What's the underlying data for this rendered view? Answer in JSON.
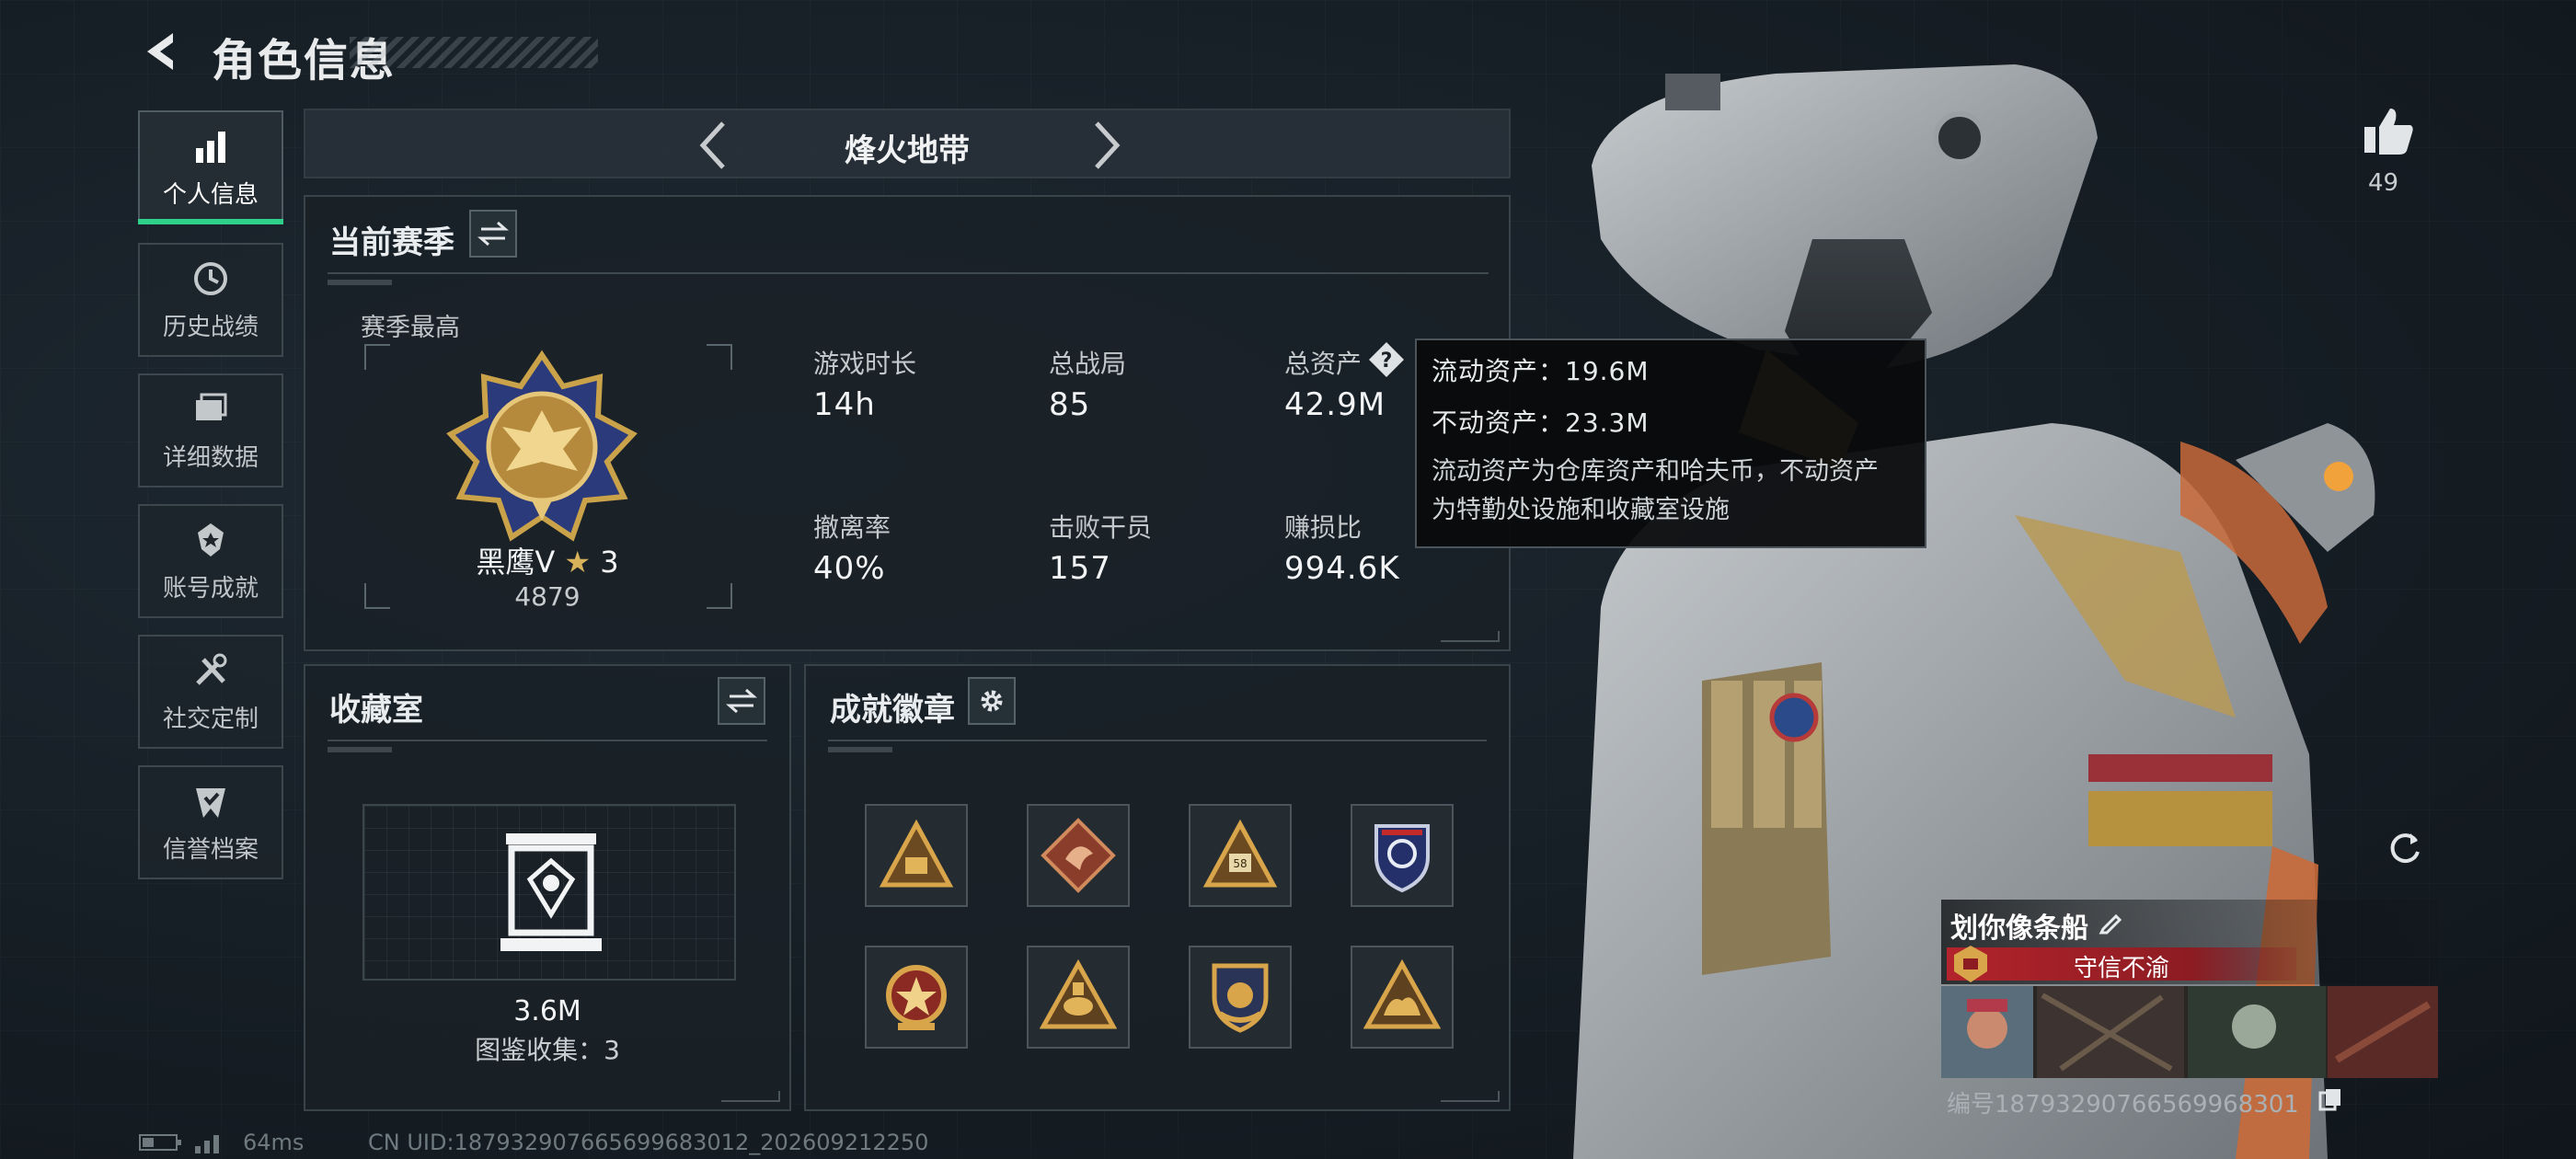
{
  "header": {
    "title": "角色信息"
  },
  "sidebar": {
    "items": [
      {
        "label": "个人信息",
        "icon": "bar-chart-icon",
        "active": true
      },
      {
        "label": "历史战绩",
        "icon": "clock-history-icon",
        "active": false
      },
      {
        "label": "详细数据",
        "icon": "folder-icon",
        "active": false
      },
      {
        "label": "账号成就",
        "icon": "medal-icon",
        "active": false
      },
      {
        "label": "社交定制",
        "icon": "tools-icon",
        "active": false
      },
      {
        "label": "信誉档案",
        "icon": "shield-check-icon",
        "active": false
      }
    ]
  },
  "map_selector": {
    "current": "烽火地带"
  },
  "season": {
    "title": "当前赛季",
    "best_label": "赛季最高",
    "rank_name": "黑鹰Ⅴ",
    "rank_stars": "3",
    "rank_points": "4879",
    "stats": [
      {
        "label": "游戏时长",
        "value": "14h"
      },
      {
        "label": "总战局",
        "value": "85"
      },
      {
        "label": "总资产",
        "value": "42.9M"
      },
      {
        "label": "撤离率",
        "value": "40%"
      },
      {
        "label": "击败干员",
        "value": "157"
      },
      {
        "label": "赚损比",
        "value": "994.6K"
      }
    ]
  },
  "tooltip": {
    "liquid": "流动资产：19.6M",
    "fixed": "不动资产：23.3M",
    "desc_line1": "流动资产为仓库资产和哈夫币，不动资产",
    "desc_line2": "为特勤处设施和收藏室设施"
  },
  "collection": {
    "title": "收藏室",
    "value": "3.6M",
    "catalog": "图鉴收集：3"
  },
  "achievements": {
    "title": "成就徽章",
    "badges": [
      "warning-triangle-badge-icon",
      "dragon-diamond-badge-icon",
      "numbered-triangle-badge-icon",
      "blue-shield-badge-icon",
      "star-wreath-badge-icon",
      "elephant-triangle-badge-icon",
      "crest-shield-badge-icon",
      "camel-triangle-badge-icon"
    ]
  },
  "profile": {
    "likes": "49",
    "player_name": "划你像条船",
    "title_tag": "守信不渝",
    "serial": "编号18793290766569968301"
  },
  "status": {
    "ping": "64ms",
    "uid": "CN UID:187932907665699683012_202609212250"
  },
  "colors": {
    "accent_green": "#2fd08a",
    "tag_red": "#b3232b",
    "gold": "#c9a24a"
  }
}
